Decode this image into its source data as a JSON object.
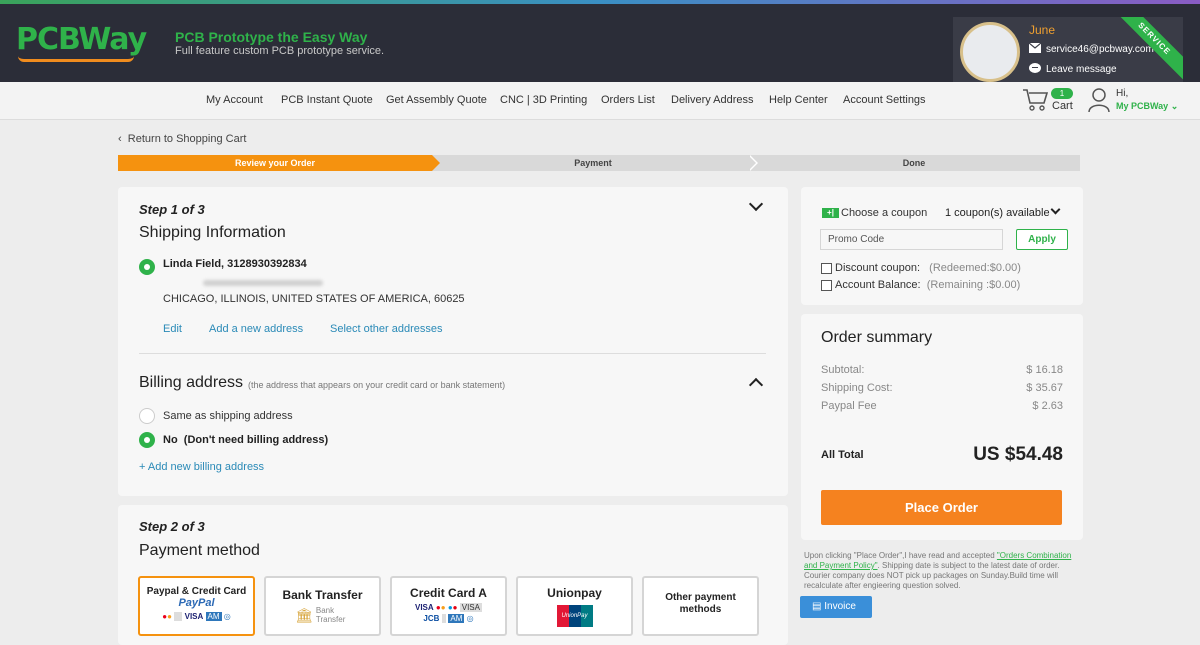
{
  "header": {
    "logo": "PCBWay",
    "tagline": "PCB Prototype the Easy Way",
    "subtag": "Full feature custom PCB prototype service.",
    "service": {
      "name": "June",
      "email": "service46@pcbway.com",
      "message": "Leave message",
      "ribbon": "SERVICE"
    }
  },
  "nav": {
    "items": [
      "My Account",
      "PCB Instant Quote",
      "Get Assembly Quote",
      "CNC | 3D Printing",
      "Orders List",
      "Delivery Address",
      "Help Center",
      "Account Settings"
    ],
    "cart_count": "1",
    "cart_label": "Cart",
    "hi": "Hi,",
    "account": "My PCBWay"
  },
  "back_link": "Return to Shopping Cart",
  "progress": {
    "steps": [
      "Review your Order",
      "Payment",
      "Done"
    ],
    "active": 0
  },
  "shipping": {
    "step": "Step 1 of 3",
    "title": "Shipping Information",
    "name_phone": "Linda Field, 3128930392834",
    "address": "CHICAGO, ILLINOIS, UNITED STATES OF AMERICA, 60625",
    "actions": [
      "Edit",
      "Add a new address",
      "Select other addresses"
    ]
  },
  "billing": {
    "title": "Billing address",
    "hint": "(the address that appears on your credit card or bank statement)",
    "options": [
      "Same as shipping address",
      "No  (Don't need billing address)"
    ],
    "add": "+ Add new billing address"
  },
  "payment": {
    "step": "Step 2 of 3",
    "title": "Payment method",
    "options": [
      "Paypal & Credit Card",
      "Bank Transfer",
      "Credit Card A",
      "Unionpay",
      "Other payment methods"
    ],
    "paypal_logo": "PayPal",
    "bank_text": "Bank Transfer",
    "unionpay_logo": "UnionPay"
  },
  "coupon": {
    "choose": "Choose a coupon",
    "available": "1 coupon(s) available",
    "promo_placeholder": "Promo Code",
    "apply": "Apply",
    "discount_label": "Discount coupon:",
    "discount_value": "(Redeemed:$0.00)",
    "balance_label": "Account Balance:",
    "balance_value": "(Remaining :$0.00)"
  },
  "summary": {
    "title": "Order summary",
    "rows": [
      {
        "label": "Subtotal:",
        "value": "$ 16.18"
      },
      {
        "label": "Shipping Cost:",
        "value": "$ 35.67"
      },
      {
        "label": "Paypal Fee",
        "value": "$ 2.63"
      }
    ],
    "total_label": "All Total",
    "total_value": "US $54.48",
    "place_order": "Place Order",
    "note_pre": "Upon clicking \"Place Order\",I have read and accepted ",
    "note_link": "\"Orders Combination and Payment Policy\"",
    "note_post": ". Shipping date is subject to the latest date of order. Courier company does NOT pick up packages on Sunday.Build time will recalculate after engieering question solved.",
    "invoice": "Invoice"
  }
}
